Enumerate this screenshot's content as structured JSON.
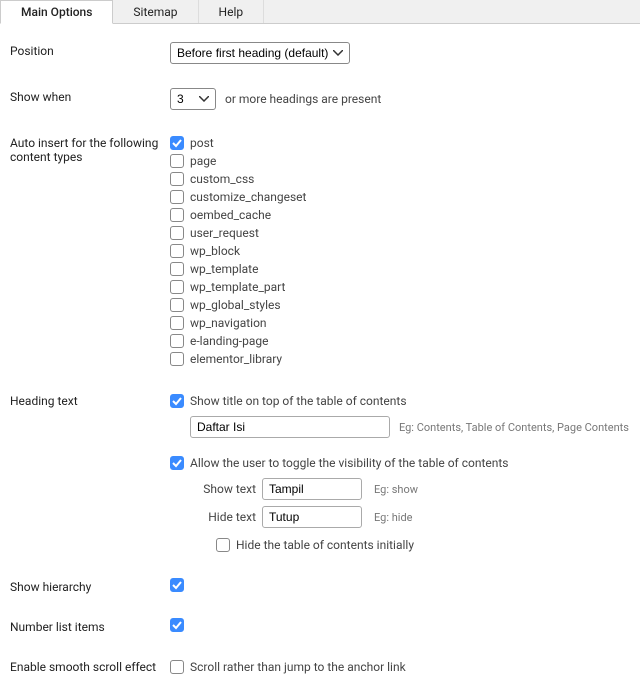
{
  "tabs": {
    "main": "Main Options",
    "sitemap": "Sitemap",
    "help": "Help"
  },
  "position": {
    "label": "Position",
    "value": "Before first heading (default)"
  },
  "show_when": {
    "label": "Show when",
    "value": "3",
    "suffix": "or more headings are present"
  },
  "auto_insert": {
    "label": "Auto insert for the following content types",
    "items": [
      {
        "label": "post",
        "checked": true
      },
      {
        "label": "page",
        "checked": false
      },
      {
        "label": "custom_css",
        "checked": false
      },
      {
        "label": "customize_changeset",
        "checked": false
      },
      {
        "label": "oembed_cache",
        "checked": false
      },
      {
        "label": "user_request",
        "checked": false
      },
      {
        "label": "wp_block",
        "checked": false
      },
      {
        "label": "wp_template",
        "checked": false
      },
      {
        "label": "wp_template_part",
        "checked": false
      },
      {
        "label": "wp_global_styles",
        "checked": false
      },
      {
        "label": "wp_navigation",
        "checked": false
      },
      {
        "label": "e-landing-page",
        "checked": false
      },
      {
        "label": "elementor_library",
        "checked": false
      }
    ]
  },
  "heading_text": {
    "label": "Heading text",
    "show_title_checked": true,
    "show_title_label": "Show title on top of the table of contents",
    "title_value": "Daftar Isi",
    "title_hint": "Eg: Contents, Table of Contents, Page Contents",
    "allow_toggle_checked": true,
    "allow_toggle_label": "Allow the user to toggle the visibility of the table of contents",
    "show_text_label": "Show text",
    "show_text_value": "Tampil",
    "show_text_hint": "Eg: show",
    "hide_text_label": "Hide text",
    "hide_text_value": "Tutup",
    "hide_text_hint": "Eg: hide",
    "hide_initially_checked": false,
    "hide_initially_label": "Hide the table of contents initially"
  },
  "show_hierarchy": {
    "label": "Show hierarchy",
    "checked": true
  },
  "number_list": {
    "label": "Number list items",
    "checked": true
  },
  "smooth_scroll": {
    "label": "Enable smooth scroll effect",
    "checked": false,
    "text": "Scroll rather than jump to the anchor link"
  }
}
